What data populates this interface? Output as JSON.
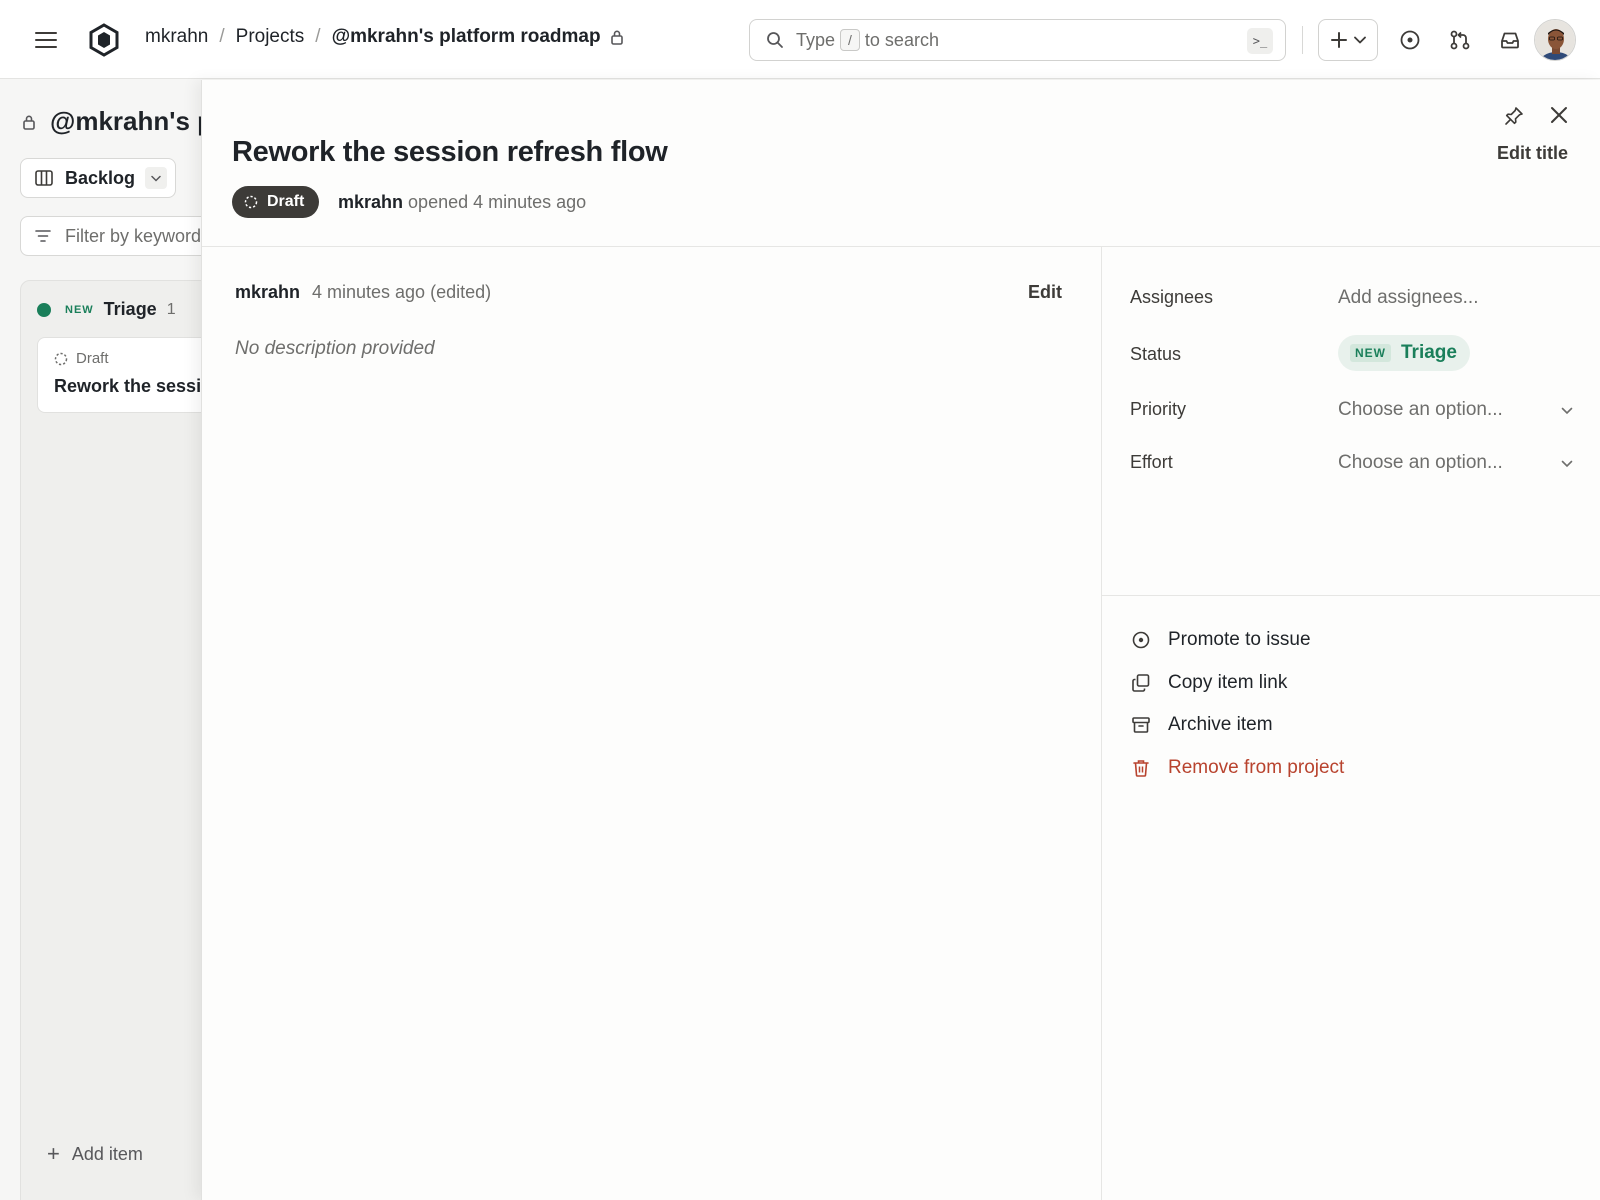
{
  "header": {
    "breadcrumb": [
      "mkrahn",
      "Projects",
      "@mkrahn's platform roadmap"
    ],
    "separator": "/",
    "search": {
      "prefix": "Type",
      "key": "/",
      "suffix": "to search",
      "command_glyph": ">_"
    },
    "icons": [
      "menu-icon",
      "logo-icon",
      "lock-icon",
      "search-icon",
      "plus-icon",
      "issue-icon",
      "pull-request-icon",
      "inbox-icon"
    ]
  },
  "board": {
    "title": "@mkrahn's platform roadmap",
    "view_label": "Backlog",
    "filter_placeholder": "Filter by keyword or by field",
    "column": {
      "tag": "NEW",
      "name": "Triage",
      "count": "1",
      "color": "#1a7f5a"
    },
    "card": {
      "state": "Draft",
      "title": "Rework the session refresh flow"
    },
    "add_item_label": "Add item"
  },
  "panel": {
    "title": "Rework the session refresh flow",
    "state": "Draft",
    "opened_by": "mkrahn",
    "opened_text": "opened 4 minutes ago",
    "edit_title_label": "Edit title",
    "comment": {
      "author": "mkrahn",
      "time": "4 minutes ago (edited)",
      "edit_label": "Edit",
      "body": "No description provided"
    },
    "fields": {
      "assignees": {
        "label": "Assignees",
        "value": "Add assignees..."
      },
      "status": {
        "label": "Status",
        "tag": "NEW",
        "value": "Triage"
      },
      "priority": {
        "label": "Priority",
        "value": "Choose an option..."
      },
      "effort": {
        "label": "Effort",
        "value": "Choose an option..."
      }
    },
    "actions": {
      "promote": "Promote to issue",
      "copy_link": "Copy item link",
      "archive": "Archive item",
      "remove": "Remove from project"
    }
  },
  "colors": {
    "accent_green": "#1a7f5a",
    "danger": "#b8432e",
    "draft_pill": "#3d3b38"
  }
}
